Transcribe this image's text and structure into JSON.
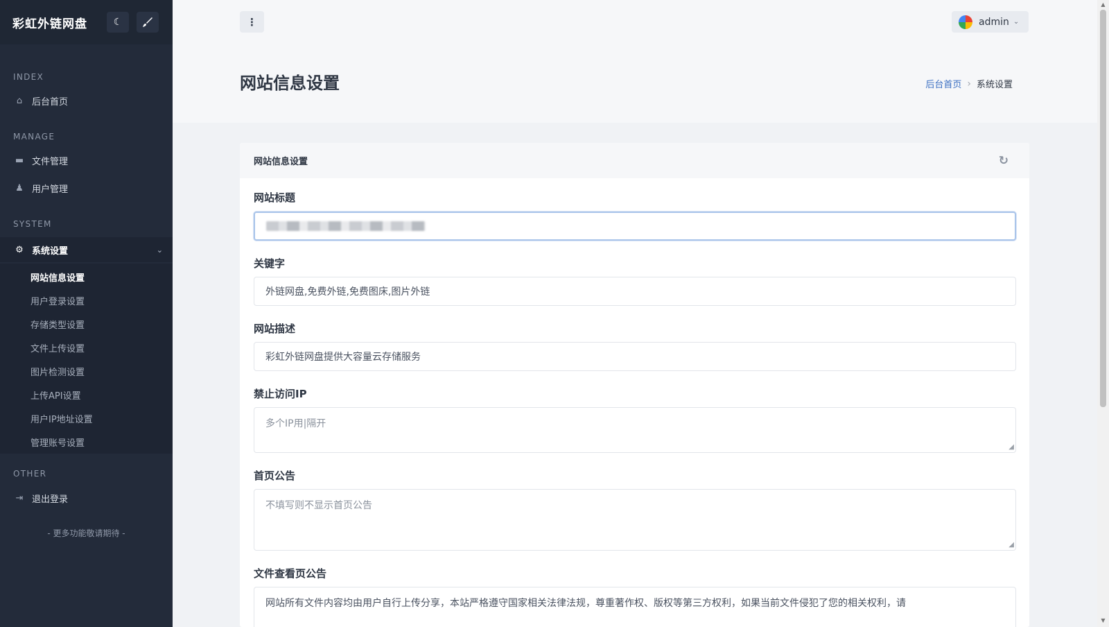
{
  "sidebar": {
    "brand": "彩虹外链网盘",
    "sections": {
      "index": "INDEX",
      "manage": "MANAGE",
      "system": "SYSTEM",
      "other": "OTHER"
    },
    "items": {
      "home": "后台首页",
      "files": "文件管理",
      "users": "用户管理",
      "settings": "系统设置",
      "logout": "退出登录"
    },
    "submenu": [
      "网站信息设置",
      "用户登录设置",
      "存储类型设置",
      "文件上传设置",
      "图片检测设置",
      "上传API设置",
      "用户IP地址设置",
      "管理账号设置"
    ],
    "footer": "- 更多功能敬请期待 -"
  },
  "topbar": {
    "menu_glyph": "⋮",
    "user": "admin"
  },
  "page": {
    "title": "网站信息设置",
    "breadcrumb": {
      "home": "后台首页",
      "current": "系统设置"
    }
  },
  "card": {
    "title": "网站信息设置",
    "fields": {
      "title_label": "网站标题",
      "keywords_label": "关键字",
      "keywords_value": "外链网盘,免费外链,免费图床,图片外链",
      "desc_label": "网站描述",
      "desc_value": "彩虹外链网盘提供大容量云存储服务",
      "blockip_label": "禁止访问IP",
      "blockip_placeholder": "多个IP用|隔开",
      "notice_label": "首页公告",
      "notice_placeholder": "不填写则不显示首页公告",
      "fileview_label": "文件查看页公告",
      "fileview_value": "网站所有文件内容均由用户自行上传分享，本站严格遵守国家相关法律法规，尊重著作权、版权等第三方权利，如果当前文件侵犯了您的相关权利，请"
    }
  },
  "icons": {
    "moon": "moon-icon",
    "brush": "brush-icon",
    "home": "home-icon",
    "folder": "folder-icon",
    "users": "users-icon",
    "gear": "gear-icon",
    "logout": "logout-icon",
    "refresh": "refresh-icon"
  }
}
